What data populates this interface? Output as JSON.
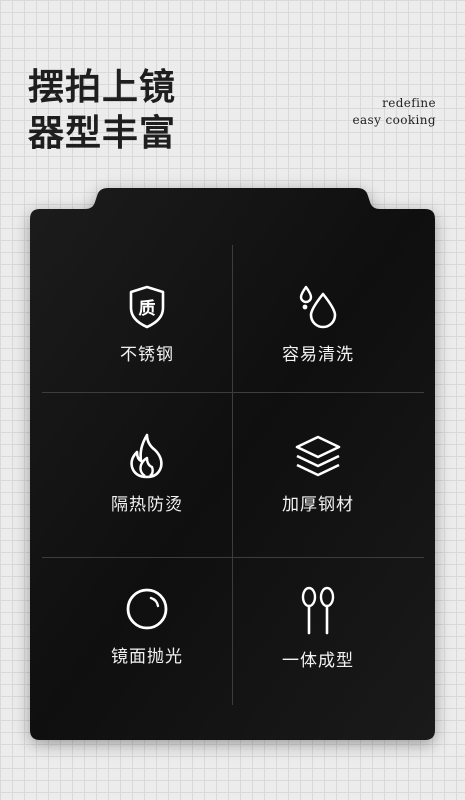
{
  "header": {
    "line1": "摆拍上镜",
    "line2": "器型丰富",
    "tag1": "redefine",
    "tag2": "easy cooking"
  },
  "features": [
    {
      "label": "不锈钢",
      "icon": "shield-quality-icon",
      "icon_text": "质"
    },
    {
      "label": "容易清洗",
      "icon": "water-drops-icon"
    },
    {
      "label": "隔热防烫",
      "icon": "flame-icon"
    },
    {
      "label": "加厚钢材",
      "icon": "layers-icon"
    },
    {
      "label": "镜面抛光",
      "icon": "mirror-circle-icon"
    },
    {
      "label": "一体成型",
      "icon": "spoons-icon"
    }
  ],
  "colors": {
    "panel": "#111111",
    "background": "#ececec",
    "text_dark": "#1e1e1e",
    "text_light": "#f2f2f2"
  }
}
